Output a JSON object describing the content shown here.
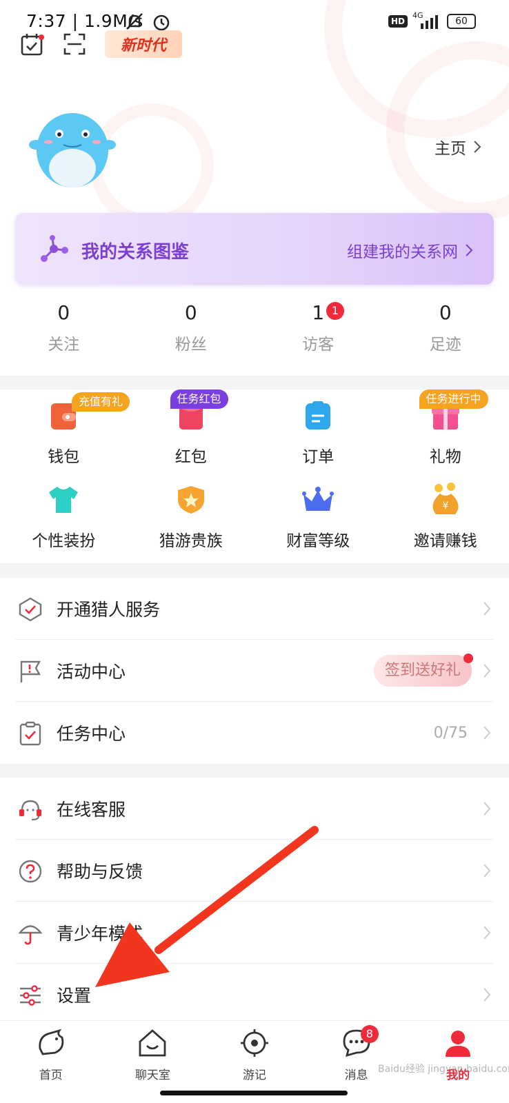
{
  "status_bar": {
    "time": "7:37 | 1.9M/s",
    "battery": "60",
    "network": "4G",
    "hd": "HD"
  },
  "header": {
    "brand_badge": "新时代"
  },
  "profile": {
    "homepage_label": "主页"
  },
  "relation_card": {
    "title": "我的关系图鉴",
    "link": "组建我的关系网"
  },
  "stats": [
    {
      "value": "0",
      "label": "关注"
    },
    {
      "value": "0",
      "label": "粉丝"
    },
    {
      "value": "1",
      "label": "访客",
      "badge": "1"
    },
    {
      "value": "0",
      "label": "足迹"
    }
  ],
  "grid": [
    {
      "label": "钱包",
      "tag": "充值有礼",
      "icon": "wallet-icon"
    },
    {
      "label": "红包",
      "tag": "任务红包",
      "icon": "red-envelope-icon"
    },
    {
      "label": "订单",
      "icon": "order-icon"
    },
    {
      "label": "礼物",
      "tag": "任务进行中",
      "icon": "gift-icon"
    },
    {
      "label": "个性装扮",
      "icon": "tshirt-icon"
    },
    {
      "label": "猎游贵族",
      "icon": "noble-badge-icon"
    },
    {
      "label": "财富等级",
      "icon": "crown-icon"
    },
    {
      "label": "邀请赚钱",
      "icon": "money-bag-icon"
    }
  ],
  "services": [
    {
      "label": "开通猎人服务",
      "icon": "shield-check-icon"
    },
    {
      "label": "活动中心",
      "icon": "flag-icon",
      "pill": "签到送好礼"
    },
    {
      "label": "任务中心",
      "icon": "clipboard-check-icon",
      "right": "0/75"
    }
  ],
  "support": [
    {
      "label": "在线客服",
      "icon": "headset-icon"
    },
    {
      "label": "帮助与反馈",
      "icon": "help-icon"
    },
    {
      "label": "青少年模式",
      "icon": "umbrella-icon"
    },
    {
      "label": "设置",
      "icon": "settings-sliders-icon"
    }
  ],
  "tabbar": [
    {
      "label": "首页",
      "icon": "home-icon"
    },
    {
      "label": "聊天室",
      "icon": "chatroom-icon"
    },
    {
      "label": "游记",
      "icon": "target-icon"
    },
    {
      "label": "消息",
      "icon": "message-icon",
      "badge": "8"
    },
    {
      "label": "我的",
      "icon": "profile-icon",
      "active": true
    }
  ],
  "watermark": "Baidu经验 jingyan.baidu.com"
}
